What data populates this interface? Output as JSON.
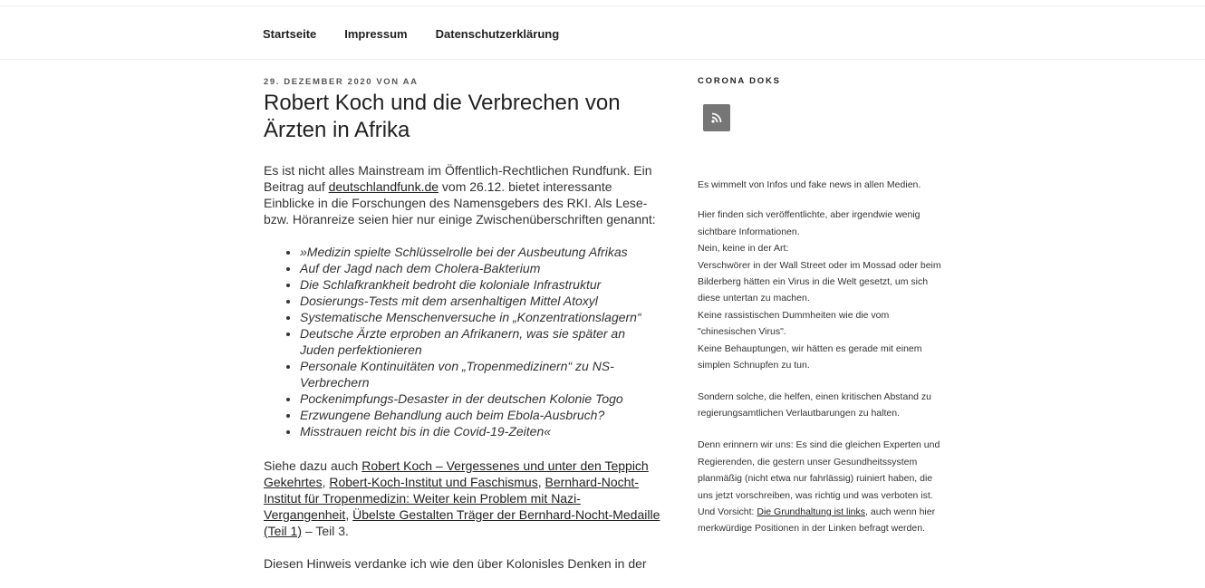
{
  "nav": {
    "items": [
      "Startseite",
      "Impressum",
      "Datenschutzerklärung"
    ]
  },
  "post": {
    "meta": "29. Dezember 2020 von AA",
    "title": "Robert Koch und die Verbrechen von Ärzten in Afrika",
    "intro": {
      "before": "Es ist nicht alles Mainstream im Öffentlich-Rechtlichen Rundfunk. Ein Beitrag auf ",
      "link": "deutschlandfunk.de",
      "after": " vom 26.12. bietet interessante Einblicke in die Forschungen des Namensgebers des RKI. Als Lese- bzw. Höranreize seien hier nur einige Zwischenüberschriften genannt:"
    },
    "list": [
      "»Medizin spielte Schlüsselrolle bei der Ausbeutung Afrikas",
      "Auf der Jagd nach dem Cholera-Bakterium",
      "Die Schlafkrankheit bedroht die koloniale Infrastruktur",
      "Dosierungs-Tests mit dem arsenhaltigen Mittel Atoxyl",
      "Systematische Menschenversuche in „Konzentrationslagern“",
      "Deutsche Ärzte erproben an Afrikanern, was sie später an Juden perfektionieren",
      "Personale Kontinuitäten von „Tropenmedizinern“ zu NS-Verbrechern",
      "Pockenimpfungs-Desaster in der deutschen Kolonie Togo",
      "Erzwungene Behandlung auch beim Ebola-Ausbruch?",
      "Misstrauen reicht bis in die Covid-19-Zeiten«"
    ],
    "see_also": {
      "prefix": "Siehe dazu auch ",
      "link1": "Robert Koch – Vergessenes und unter den Teppich Gekehrtes",
      "sep1": ", ",
      "link2": "Robert-Koch-Institut und Faschismus",
      "sep2": ", ",
      "link3": "Bernhard-Nocht-Institut für Tropenmedizin: Weiter kein Problem mit Nazi-Vergangenheit",
      "sep3": ", ",
      "link4": "Übelste Gestalten Träger der Bernhard-Nocht-Medaille (Teil 1)",
      "suffix": " – Teil 3."
    },
    "cut_line": "Diesen Hinweis verdanke ich wie den über Kolonisles Denken in der"
  },
  "sidebar": {
    "widget_title": "Corona Doks",
    "rss_icon": "rss-icon",
    "p1": "Es wimmelt von Infos und fake news in allen Medien.",
    "p2_lines": [
      "Hier finden sich veröffentlichte, aber irgendwie wenig sichtbare Informationen.",
      "Nein, keine in der Art:",
      "Verschwörer in der Wall Street oder im Mossad oder beim Bilderberg hätten ein Virus in die Welt gesetzt, um sich diese untertan zu machen.",
      "Keine rassistischen Dummheiten wie die vom \"chinesischen Virus\".",
      "Keine Behauptungen, wir hätten es gerade mit einem simplen Schnupfen zu tun."
    ],
    "p3": "Sondern solche, die helfen, einen kritischen Abstand zu regierungsamtlichen Verlautbarungen zu halten.",
    "p4": {
      "before": "Denn erinnern wir uns: Es sind die gleichen Experten und Regierenden, die gestern unser Gesundheitssystem planmäßig (nicht etwa nur fahrlässig) ruiniert haben, die uns jetzt vorschreiben, was richtig und was verboten ist. Und Vorsicht: ",
      "link": "Die Grundhaltung ist links",
      "after": ", auch wenn hier merkwürdige Positionen in der Linken befragt werden."
    }
  }
}
